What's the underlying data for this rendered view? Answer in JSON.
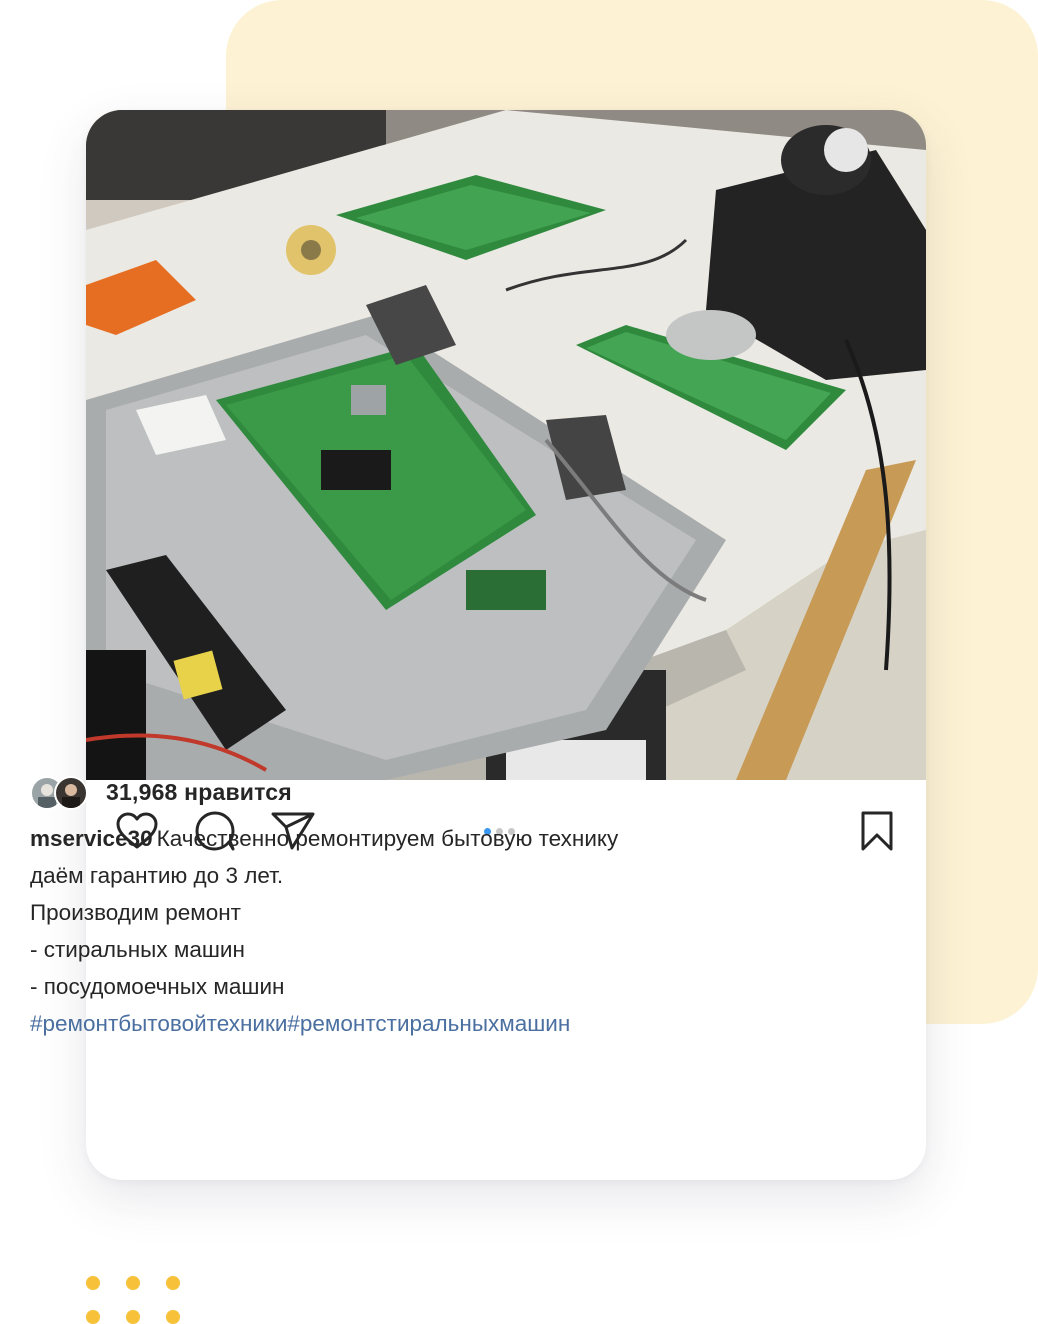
{
  "post": {
    "photo_icon": "post-photo",
    "carousel": {
      "count": 3,
      "active_index": 0
    },
    "actions": {
      "like_icon": "heart-icon",
      "comment_icon": "comment-bubble-icon",
      "share_icon": "paper-plane-icon",
      "save_icon": "bookmark-icon"
    },
    "likes": {
      "count_label": "31,968 нравится"
    },
    "caption": {
      "username": "mservice30",
      "line1": "Качественно ремонтируем бытовую технику",
      "line2": "даём гарантию до 3 лет.",
      "line3": "Производим ремонт",
      "line4": "- стиральных машин",
      "line5": "- посудомоечных машин",
      "hashtags": "#ремонтбытовойтехники#ремонтстиральныхмашин"
    }
  },
  "colors": {
    "backdrop": "#fdf2d3",
    "accent_dots": "#f7c13a",
    "hashtag": "#4a6fa0",
    "carousel_active": "#3897f0",
    "text": "#262626"
  }
}
